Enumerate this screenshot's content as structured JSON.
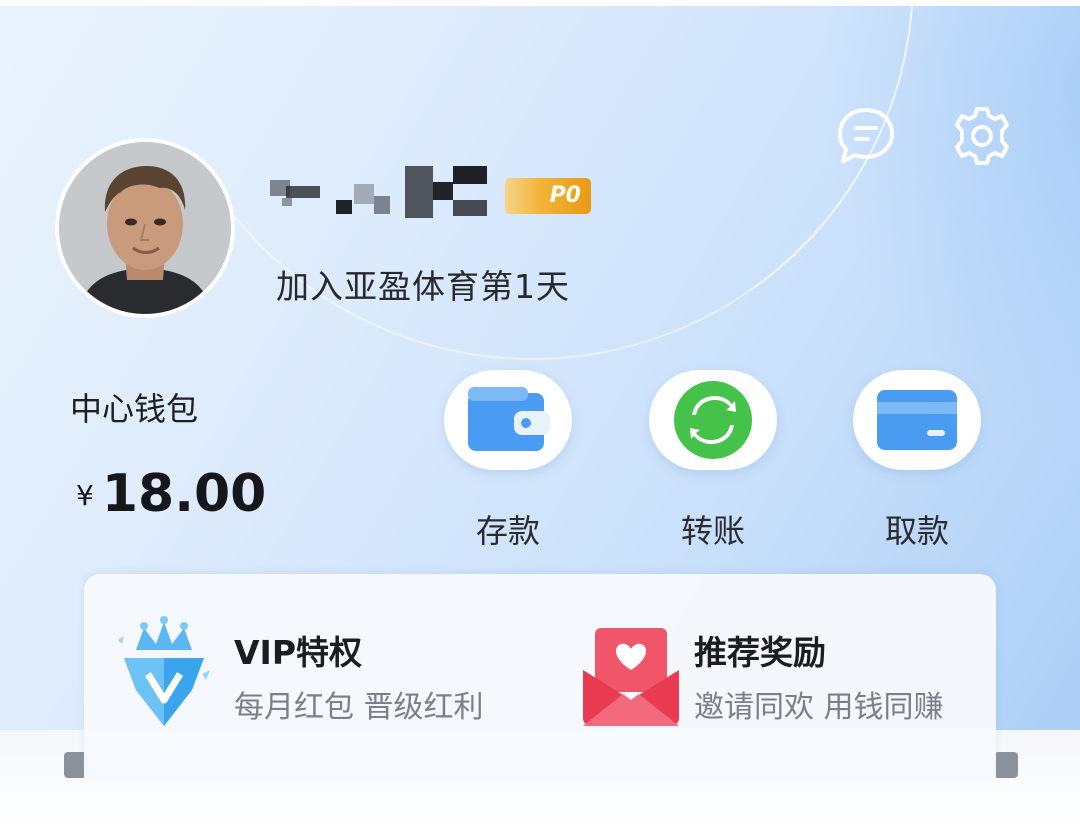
{
  "profile": {
    "vip_level": "P0",
    "join_text": "加入亚盈体育第1天"
  },
  "header": {
    "chat_icon": "chat-bubble-icon",
    "settings_icon": "gear-icon"
  },
  "wallet": {
    "label": "中心钱包",
    "currency": "¥",
    "balance": "18.00"
  },
  "actions": [
    {
      "label": "存款",
      "icon": "wallet-icon"
    },
    {
      "label": "转账",
      "icon": "transfer-icon"
    },
    {
      "label": "取款",
      "icon": "card-icon"
    }
  ],
  "perks": [
    {
      "title": "VIP特权",
      "subtitle": "每月红包 晋级红利",
      "icon": "diamond-crown-icon"
    },
    {
      "title": "推荐奖励",
      "subtitle": "邀请同欢 用钱同赚",
      "icon": "heart-envelope-icon"
    }
  ],
  "colors": {
    "accent_blue": "#3b8ef0",
    "transfer_green": "#44c24a",
    "vip_gold": "#f2b53a",
    "envelope_red": "#ee3d55"
  }
}
